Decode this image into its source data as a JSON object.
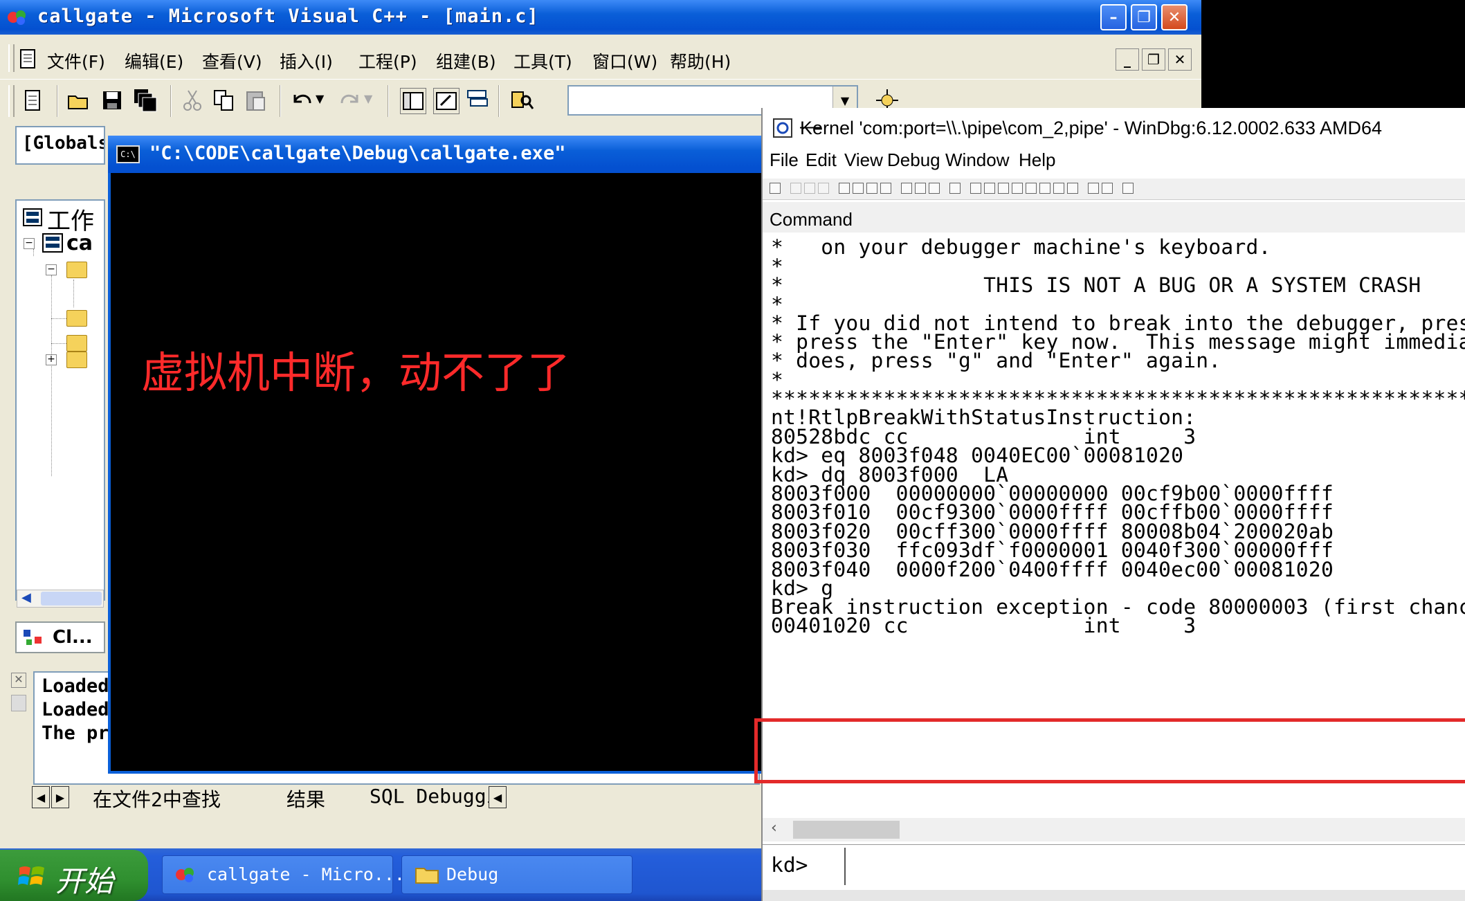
{
  "vc": {
    "title": "callgate - Microsoft Visual C++ - [main.c]",
    "menu": [
      "文件(F)",
      "编辑(E)",
      "查看(V)",
      "插入(I)",
      "工程(P)",
      "组建(B)",
      "工具(T)",
      "窗口(W)",
      "帮助(H)"
    ],
    "globals_label": "[Globals",
    "workspace_title": "工作",
    "workspace_project": "ca",
    "classview_tab": "Cl...",
    "output_lines": [
      "Loaded",
      "Loaded",
      "The pr"
    ],
    "output_tabs": [
      "在文件2中查找",
      "结果",
      "SQL Debuggi"
    ]
  },
  "console": {
    "title": "\"C:\\CODE\\callgate\\Debug\\callgate.exe\"",
    "icon_text": "C:\\",
    "annotation": "虚拟机中断，动不了了"
  },
  "taskbar": {
    "start_label": "开始",
    "items": [
      "callgate - Micro...",
      "Debug"
    ]
  },
  "windbg": {
    "title": "Kernel 'com:port=\\\\.\\pipe\\com_2,pipe' - WinDbg:6.12.0002.633 AMD64",
    "menu": [
      "File",
      "Edit",
      "View",
      "Debug",
      "Window",
      "Help"
    ],
    "pane_title": "Command",
    "lines": [
      "*   on your debugger machine's keyboard.",
      "*",
      "*                THIS IS NOT A BUG OR A SYSTEM CRASH",
      "*",
      "* If you did not intend to break into the debugger, pres",
      "* press the \"Enter\" key now.  This message might immedia",
      "* does, press \"g\" and \"Enter\" again.",
      "*",
      "**********************************************************************",
      "nt!RtlpBreakWithStatusInstruction:",
      "80528bdc cc              int     3",
      "kd> eq 8003f048 0040EC00`00081020",
      "kd> dq 8003f000  LA",
      "8003f000  00000000`00000000 00cf9b00`0000ffff",
      "8003f010  00cf9300`0000ffff 00cffb00`0000ffff",
      "8003f020  00cff300`0000ffff 80008b04`200020ab",
      "8003f030  ffc093df`f0000001 0040f300`00000fff",
      "8003f040  0000f200`0400ffff 0040ec00`00081020",
      "kd> g",
      "Break instruction exception - code 80000003 (first chanc",
      "00401020 cc              int     3"
    ],
    "prompt": "kd>"
  },
  "colors": {
    "xp_blue": "#0a5fd8",
    "annotation_red": "#ff2a2a",
    "highlight_red": "#e32a2a"
  }
}
